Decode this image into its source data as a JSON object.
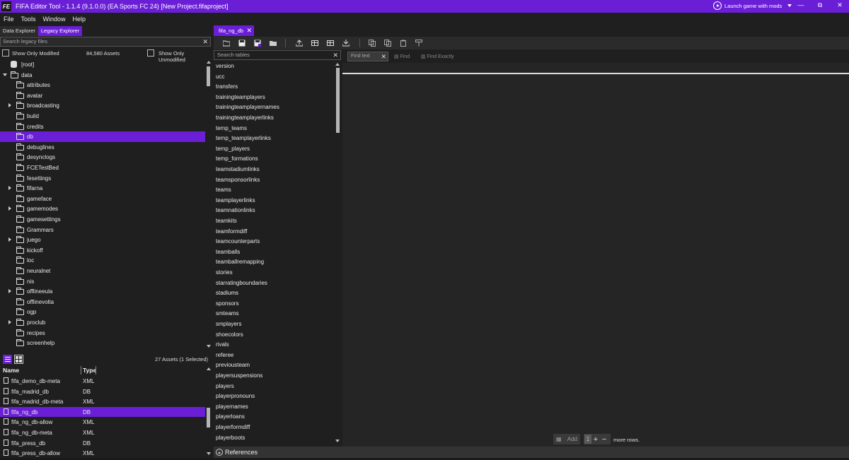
{
  "window": {
    "logo": "FE",
    "title": "FIFA Editor Tool - 1.1.4 (9.1.0.0) (EA Sports FC 24) [New Project.fifaproject]",
    "launch_label": "Launch game with mods",
    "minimize": "—",
    "maximize": "⧉",
    "close": "✕"
  },
  "menu": [
    "File",
    "Tools",
    "Window",
    "Help"
  ],
  "left": {
    "tabs": [
      "Data Explorer",
      "Legacy Explorer"
    ],
    "active_tab": 1,
    "search_placeholder": "Search legacy files",
    "show_only_modified": "Show Only Modified",
    "asset_count": "84,580 Assets",
    "show_only_unmodified": "Show Only Unmodified",
    "tree": [
      {
        "label": "[root]",
        "icon": "database-icon",
        "level": 0,
        "arrow": "none"
      },
      {
        "label": "data",
        "icon": "folder-open-icon",
        "level": 0,
        "arrow": "down"
      },
      {
        "label": "attributes",
        "level": 1,
        "arrow": "none"
      },
      {
        "label": "avatar",
        "level": 1,
        "arrow": "none"
      },
      {
        "label": "broadcasting",
        "level": 1,
        "arrow": "right"
      },
      {
        "label": "build",
        "level": 1,
        "arrow": "none"
      },
      {
        "label": "credits",
        "level": 1,
        "arrow": "none"
      },
      {
        "label": "db",
        "level": 1,
        "arrow": "none",
        "selected": true
      },
      {
        "label": "debuglines",
        "level": 1,
        "arrow": "none"
      },
      {
        "label": "desynclogs",
        "level": 1,
        "arrow": "none"
      },
      {
        "label": "FCETestBed",
        "level": 1,
        "arrow": "none"
      },
      {
        "label": "fesettings",
        "level": 1,
        "arrow": "none"
      },
      {
        "label": "fifarna",
        "level": 1,
        "arrow": "right"
      },
      {
        "label": "gameface",
        "level": 1,
        "arrow": "none"
      },
      {
        "label": "gamemodes",
        "level": 1,
        "arrow": "right"
      },
      {
        "label": "gamesettings",
        "level": 1,
        "arrow": "none"
      },
      {
        "label": "Grammars",
        "level": 1,
        "arrow": "none"
      },
      {
        "label": "juego",
        "level": 1,
        "arrow": "right"
      },
      {
        "label": "kickoff",
        "level": 1,
        "arrow": "none"
      },
      {
        "label": "loc",
        "level": 1,
        "arrow": "none"
      },
      {
        "label": "neuralnet",
        "level": 1,
        "arrow": "none"
      },
      {
        "label": "nis",
        "level": 1,
        "arrow": "none"
      },
      {
        "label": "offlineeula",
        "level": 1,
        "arrow": "right"
      },
      {
        "label": "offlinevolta",
        "level": 1,
        "arrow": "none"
      },
      {
        "label": "ogp",
        "level": 1,
        "arrow": "none"
      },
      {
        "label": "proclub",
        "level": 1,
        "arrow": "right"
      },
      {
        "label": "recipes",
        "level": 1,
        "arrow": "none"
      },
      {
        "label": "screenhelp",
        "level": 1,
        "arrow": "none"
      }
    ],
    "assets_status": "27 Assets (1 Selected)",
    "file_columns": {
      "name": "Name",
      "type": "Type"
    },
    "files": [
      {
        "name": "fifa_demo_db-meta",
        "type": "XML"
      },
      {
        "name": "fifa_madrid_db",
        "type": "DB"
      },
      {
        "name": "fifa_madrid_db-meta",
        "type": "XML"
      },
      {
        "name": "fifa_ng_db",
        "type": "DB",
        "selected": true
      },
      {
        "name": "fifa_ng_db-allow",
        "type": "XML"
      },
      {
        "name": "fifa_ng_db-meta",
        "type": "XML"
      },
      {
        "name": "fifa_press_db",
        "type": "DB"
      },
      {
        "name": "fifa_press_db-allow",
        "type": "XML"
      }
    ]
  },
  "editor": {
    "tab_label": "fifa_ng_db",
    "tab_close": "✕",
    "tables_search_placeholder": "Search tables",
    "tables": [
      "version",
      "ucc",
      "transfers",
      "trainingteamplayers",
      "trainingteamplayernames",
      "trainingteamplayerlinks",
      "temp_teams",
      "temp_teamplayerlinks",
      "temp_players",
      "temp_formations",
      "teamstadiumlinks",
      "teamsponsorlinks",
      "teams",
      "teamplayerlinks",
      "teamnationlinks",
      "teamkits",
      "teamformdiff",
      "teamcounterparts",
      "teamballs",
      "teamballremapping",
      "stories",
      "starratingboundaries",
      "stadiums",
      "sponsors",
      "smteams",
      "smplayers",
      "shoecolors",
      "rivals",
      "referee",
      "previousteam",
      "playersuspensions",
      "players",
      "playerpronouns",
      "playernames",
      "playerloans",
      "playerformdiff",
      "playerboots"
    ],
    "find_placeholder": "Find text",
    "find_label": "Find",
    "find_exactly_label": "Find Exactly",
    "add_label": "Add",
    "rows_value": "1",
    "more_rows_label": "more rows.",
    "references_label": "References"
  },
  "colors": {
    "accent": "#6a1fd6",
    "background": "#1f1f1f"
  }
}
